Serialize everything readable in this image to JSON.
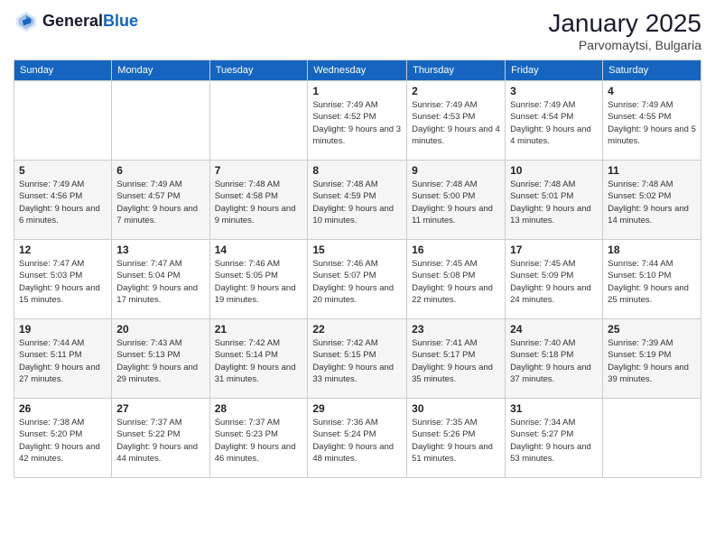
{
  "logo": {
    "general": "General",
    "blue": "Blue"
  },
  "header": {
    "month": "January 2025",
    "location": "Parvomaytsi, Bulgaria"
  },
  "weekdays": [
    "Sunday",
    "Monday",
    "Tuesday",
    "Wednesday",
    "Thursday",
    "Friday",
    "Saturday"
  ],
  "weeks": [
    [
      {
        "day": "",
        "info": ""
      },
      {
        "day": "",
        "info": ""
      },
      {
        "day": "",
        "info": ""
      },
      {
        "day": "1",
        "info": "Sunrise: 7:49 AM\nSunset: 4:52 PM\nDaylight: 9 hours and 3 minutes."
      },
      {
        "day": "2",
        "info": "Sunrise: 7:49 AM\nSunset: 4:53 PM\nDaylight: 9 hours and 4 minutes."
      },
      {
        "day": "3",
        "info": "Sunrise: 7:49 AM\nSunset: 4:54 PM\nDaylight: 9 hours and 4 minutes."
      },
      {
        "day": "4",
        "info": "Sunrise: 7:49 AM\nSunset: 4:55 PM\nDaylight: 9 hours and 5 minutes."
      }
    ],
    [
      {
        "day": "5",
        "info": "Sunrise: 7:49 AM\nSunset: 4:56 PM\nDaylight: 9 hours and 6 minutes."
      },
      {
        "day": "6",
        "info": "Sunrise: 7:49 AM\nSunset: 4:57 PM\nDaylight: 9 hours and 7 minutes."
      },
      {
        "day": "7",
        "info": "Sunrise: 7:48 AM\nSunset: 4:58 PM\nDaylight: 9 hours and 9 minutes."
      },
      {
        "day": "8",
        "info": "Sunrise: 7:48 AM\nSunset: 4:59 PM\nDaylight: 9 hours and 10 minutes."
      },
      {
        "day": "9",
        "info": "Sunrise: 7:48 AM\nSunset: 5:00 PM\nDaylight: 9 hours and 11 minutes."
      },
      {
        "day": "10",
        "info": "Sunrise: 7:48 AM\nSunset: 5:01 PM\nDaylight: 9 hours and 13 minutes."
      },
      {
        "day": "11",
        "info": "Sunrise: 7:48 AM\nSunset: 5:02 PM\nDaylight: 9 hours and 14 minutes."
      }
    ],
    [
      {
        "day": "12",
        "info": "Sunrise: 7:47 AM\nSunset: 5:03 PM\nDaylight: 9 hours and 15 minutes."
      },
      {
        "day": "13",
        "info": "Sunrise: 7:47 AM\nSunset: 5:04 PM\nDaylight: 9 hours and 17 minutes."
      },
      {
        "day": "14",
        "info": "Sunrise: 7:46 AM\nSunset: 5:05 PM\nDaylight: 9 hours and 19 minutes."
      },
      {
        "day": "15",
        "info": "Sunrise: 7:46 AM\nSunset: 5:07 PM\nDaylight: 9 hours and 20 minutes."
      },
      {
        "day": "16",
        "info": "Sunrise: 7:45 AM\nSunset: 5:08 PM\nDaylight: 9 hours and 22 minutes."
      },
      {
        "day": "17",
        "info": "Sunrise: 7:45 AM\nSunset: 5:09 PM\nDaylight: 9 hours and 24 minutes."
      },
      {
        "day": "18",
        "info": "Sunrise: 7:44 AM\nSunset: 5:10 PM\nDaylight: 9 hours and 25 minutes."
      }
    ],
    [
      {
        "day": "19",
        "info": "Sunrise: 7:44 AM\nSunset: 5:11 PM\nDaylight: 9 hours and 27 minutes."
      },
      {
        "day": "20",
        "info": "Sunrise: 7:43 AM\nSunset: 5:13 PM\nDaylight: 9 hours and 29 minutes."
      },
      {
        "day": "21",
        "info": "Sunrise: 7:42 AM\nSunset: 5:14 PM\nDaylight: 9 hours and 31 minutes."
      },
      {
        "day": "22",
        "info": "Sunrise: 7:42 AM\nSunset: 5:15 PM\nDaylight: 9 hours and 33 minutes."
      },
      {
        "day": "23",
        "info": "Sunrise: 7:41 AM\nSunset: 5:17 PM\nDaylight: 9 hours and 35 minutes."
      },
      {
        "day": "24",
        "info": "Sunrise: 7:40 AM\nSunset: 5:18 PM\nDaylight: 9 hours and 37 minutes."
      },
      {
        "day": "25",
        "info": "Sunrise: 7:39 AM\nSunset: 5:19 PM\nDaylight: 9 hours and 39 minutes."
      }
    ],
    [
      {
        "day": "26",
        "info": "Sunrise: 7:38 AM\nSunset: 5:20 PM\nDaylight: 9 hours and 42 minutes."
      },
      {
        "day": "27",
        "info": "Sunrise: 7:37 AM\nSunset: 5:22 PM\nDaylight: 9 hours and 44 minutes."
      },
      {
        "day": "28",
        "info": "Sunrise: 7:37 AM\nSunset: 5:23 PM\nDaylight: 9 hours and 46 minutes."
      },
      {
        "day": "29",
        "info": "Sunrise: 7:36 AM\nSunset: 5:24 PM\nDaylight: 9 hours and 48 minutes."
      },
      {
        "day": "30",
        "info": "Sunrise: 7:35 AM\nSunset: 5:26 PM\nDaylight: 9 hours and 51 minutes."
      },
      {
        "day": "31",
        "info": "Sunrise: 7:34 AM\nSunset: 5:27 PM\nDaylight: 9 hours and 53 minutes."
      },
      {
        "day": "",
        "info": ""
      }
    ]
  ]
}
